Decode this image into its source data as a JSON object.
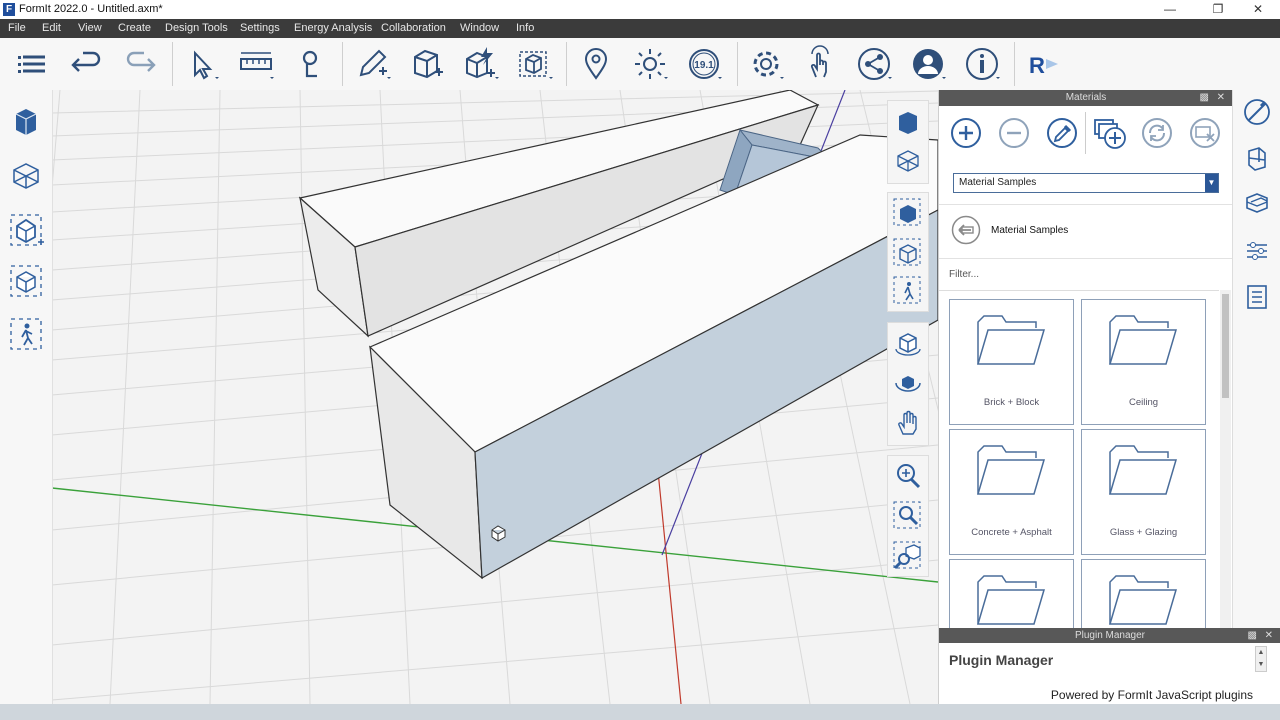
{
  "window": {
    "title": "FormIt 2022.0 - Untitled.axm*",
    "logo": "F",
    "minimize": "—",
    "maximize": "❐",
    "close": "✕"
  },
  "menu": [
    "File",
    "Edit",
    "View",
    "Create",
    "Design Tools",
    "Settings",
    "Energy Analysis",
    "Collaboration",
    "Window",
    "Info"
  ],
  "toolbar": {
    "icons": [
      "hamburger-menu-icon",
      "undo-icon",
      "redo-icon",
      "select-icon",
      "measure-icon",
      "paint-icon",
      "pencil-icon",
      "cube-add-icon",
      "cube-lightning-icon",
      "group-icon",
      "location-pin-icon",
      "sun-icon",
      "version-icon",
      "settings-gear-icon",
      "touch-gesture-icon",
      "share-icon",
      "user-icon",
      "info-icon",
      "revit-icon"
    ],
    "version_badge": "19.1",
    "revit_label": "R"
  },
  "materials": {
    "panel_title": "Materials",
    "library_select": "Material Samples",
    "breadcrumb": "Material Samples",
    "filter_placeholder": "Filter...",
    "folders": [
      "Brick + Block",
      "Ceiling",
      "Concrete + Asphalt",
      "Glass + Glazing",
      "",
      ""
    ]
  },
  "plugin_manager": {
    "panel_title": "Plugin Manager",
    "heading": "Plugin Manager",
    "footer": "Powered by FormIt JavaScript plugins"
  },
  "colors": {
    "accent": "#2b5797",
    "menubar": "#3b3b3b",
    "panel_header": "#585858",
    "icon": "#2f4f7a",
    "x_axis": "#3aa13a",
    "y_axis": "#c0392b",
    "z_axis": "#4a3fa0"
  }
}
